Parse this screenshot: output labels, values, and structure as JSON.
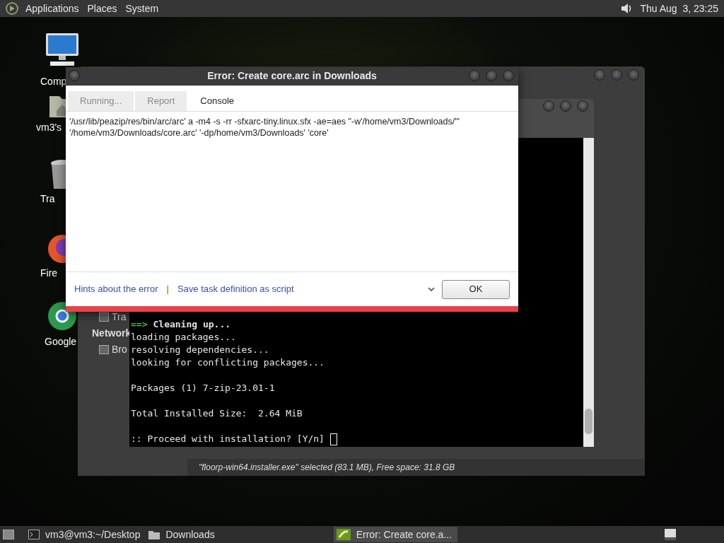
{
  "top_panel": {
    "menus": [
      "Applications",
      "Places",
      "System"
    ],
    "clock": "Thu Aug  3, 23:25"
  },
  "desktop_icons": [
    {
      "kind": "computer",
      "label": "Comp"
    },
    {
      "kind": "home",
      "label": "vm3's"
    },
    {
      "kind": "trash",
      "label": "Tra"
    },
    {
      "kind": "firefox",
      "label": "Fire"
    },
    {
      "kind": "chrome",
      "label": "Google"
    }
  ],
  "file_manager": {
    "sidebar": [
      {
        "kind": "item",
        "label": "Tra"
      },
      {
        "kind": "heading",
        "label": "Network"
      },
      {
        "kind": "item",
        "label": "Bro"
      }
    ],
    "status_bar": "\"floorp-win64.installer.exe\" selected (83.1 MB), Free space: 31.8 GB"
  },
  "terminal": {
    "lines": [
      {
        "kind": "step",
        "prefix": "==>",
        "text": "Cleaning up..."
      },
      {
        "kind": "plain",
        "text": "loading packages..."
      },
      {
        "kind": "plain",
        "text": "resolving dependencies..."
      },
      {
        "kind": "plain",
        "text": "looking for conflicting packages..."
      },
      {
        "kind": "blank"
      },
      {
        "kind": "plain",
        "text": "Packages (1) 7-zip-23.01-1"
      },
      {
        "kind": "blank"
      },
      {
        "kind": "plain",
        "text": "Total Installed Size:  2.64 MiB"
      },
      {
        "kind": "blank"
      },
      {
        "kind": "prompt",
        "text": ":: Proceed with installation? [Y/n]"
      }
    ]
  },
  "dialog": {
    "title": "Error: Create core.arc in Downloads",
    "tabs": [
      {
        "label": "Running...",
        "selected": false
      },
      {
        "label": "Report",
        "selected": false
      },
      {
        "label": "Console",
        "selected": true
      }
    ],
    "console_text": "'/usr/lib/peazip/res/bin/arc/arc' a -m4 -s -rr -sfxarc-tiny.linux.sfx -ae=aes \"-w'/home/vm3/Downloads/'\" '/home/vm3/Downloads/core.arc' '-dp/home/vm3/Downloads' 'core'",
    "links": [
      "Hints about the error",
      "Save task definition as script"
    ],
    "separator": "|",
    "ok_button": "OK"
  },
  "taskbar": [
    {
      "kind": "terminal",
      "label": "vm3@vm3:~/Desktop",
      "selected": false
    },
    {
      "kind": "folder",
      "label": "Downloads",
      "selected": false
    },
    {
      "kind": "app",
      "label": "Error: Create core.a...",
      "selected": true
    }
  ]
}
